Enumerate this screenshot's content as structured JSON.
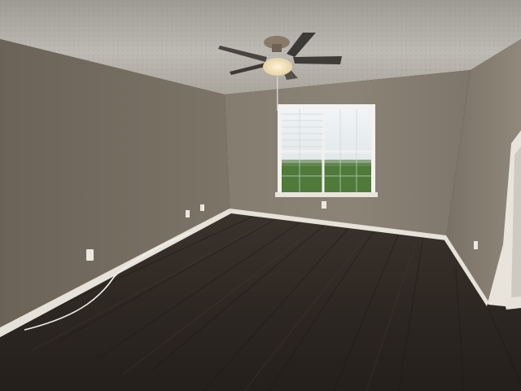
{
  "scene": {
    "subject": "empty room",
    "elements": [
      "ceiling-fan",
      "window",
      "wood-floor",
      "baseboards",
      "outlets",
      "doorway"
    ]
  },
  "colors": {
    "ceiling": "#b9b6ae",
    "left_wall": "#736a5f",
    "back_wall": "#867d71",
    "right_wall": "#8a8176",
    "floor": "#2e2823",
    "trim": "#e6e2da",
    "window_glass": "#dfe6ea",
    "lawn": "#4f7a3a"
  }
}
